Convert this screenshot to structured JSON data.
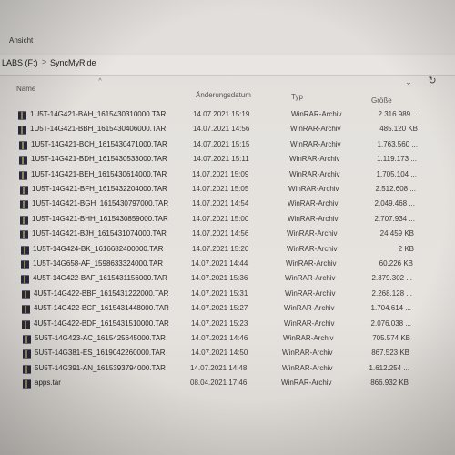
{
  "ribbon": {
    "tab_label": "Ansicht"
  },
  "address": {
    "drive": "LABS (F:)",
    "separator": ">",
    "folder": "SyncMyRide"
  },
  "columns": {
    "name": "Name",
    "date": "Änderungsdatum",
    "type": "Typ",
    "size": "Größe"
  },
  "icons": {
    "sort": "chevron-up-icon",
    "dropdown": "chevron-down-icon",
    "refresh": "refresh-icon",
    "file": "winrar-archive-icon"
  },
  "files": [
    {
      "name": "1U5T-14G421-BAH_1615430310000.TAR",
      "date": "14.07.2021 15:19",
      "type": "WinRAR-Archiv",
      "size": "2.316.989 ..."
    },
    {
      "name": "1U5T-14G421-BBH_1615430406000.TAR",
      "date": "14.07.2021 14:56",
      "type": "WinRAR-Archiv",
      "size": "485.120 KB"
    },
    {
      "name": "1U5T-14G421-BCH_1615430471000.TAR",
      "date": "14.07.2021 15:15",
      "type": "WinRAR-Archiv",
      "size": "1.763.560 ..."
    },
    {
      "name": "1U5T-14G421-BDH_1615430533000.TAR",
      "date": "14.07.2021 15:11",
      "type": "WinRAR-Archiv",
      "size": "1.119.173 ..."
    },
    {
      "name": "1U5T-14G421-BEH_1615430614000.TAR",
      "date": "14.07.2021 15:09",
      "type": "WinRAR-Archiv",
      "size": "1.705.104 ..."
    },
    {
      "name": "1U5T-14G421-BFH_1615432204000.TAR",
      "date": "14.07.2021 15:05",
      "type": "WinRAR-Archiv",
      "size": "2.512.608 ..."
    },
    {
      "name": "1U5T-14G421-BGH_1615430797000.TAR",
      "date": "14.07.2021 14:54",
      "type": "WinRAR-Archiv",
      "size": "2.049.468 ..."
    },
    {
      "name": "1U5T-14G421-BHH_1615430859000.TAR",
      "date": "14.07.2021 15:00",
      "type": "WinRAR-Archiv",
      "size": "2.707.934 ..."
    },
    {
      "name": "1U5T-14G421-BJH_1615431074000.TAR",
      "date": "14.07.2021 14:56",
      "type": "WinRAR-Archiv",
      "size": "24.459 KB"
    },
    {
      "name": "1U5T-14G424-BK_1616682400000.TAR",
      "date": "14.07.2021 15:20",
      "type": "WinRAR-Archiv",
      "size": "2 KB"
    },
    {
      "name": "1U5T-14G658-AF_1598633324000.TAR",
      "date": "14.07.2021 14:44",
      "type": "WinRAR-Archiv",
      "size": "60.226 KB"
    },
    {
      "name": "4U5T-14G422-BAF_1615431156000.TAR",
      "date": "14.07.2021 15:36",
      "type": "WinRAR-Archiv",
      "size": "2.379.302 ..."
    },
    {
      "name": "4U5T-14G422-BBF_1615431222000.TAR",
      "date": "14.07.2021 15:31",
      "type": "WinRAR-Archiv",
      "size": "2.268.128 ..."
    },
    {
      "name": "4U5T-14G422-BCF_1615431448000.TAR",
      "date": "14.07.2021 15:27",
      "type": "WinRAR-Archiv",
      "size": "1.704.614 ..."
    },
    {
      "name": "4U5T-14G422-BDF_1615431510000.TAR",
      "date": "14.07.2021 15:23",
      "type": "WinRAR-Archiv",
      "size": "2.076.038 ..."
    },
    {
      "name": "5U5T-14G423-AC_1615425645000.TAR",
      "date": "14.07.2021 14:46",
      "type": "WinRAR-Archiv",
      "size": "705.574 KB"
    },
    {
      "name": "5U5T-14G381-ES_1619042260000.TAR",
      "date": "14.07.2021 14:50",
      "type": "WinRAR-Archiv",
      "size": "867.523 KB"
    },
    {
      "name": "5U5T-14G391-AN_1615393794000.TAR",
      "date": "14.07.2021 14:48",
      "type": "WinRAR-Archiv",
      "size": "1.612.254 ..."
    },
    {
      "name": "apps.tar",
      "date": "08.04.2021 17:46",
      "type": "WinRAR-Archiv",
      "size": "866.932 KB"
    }
  ]
}
